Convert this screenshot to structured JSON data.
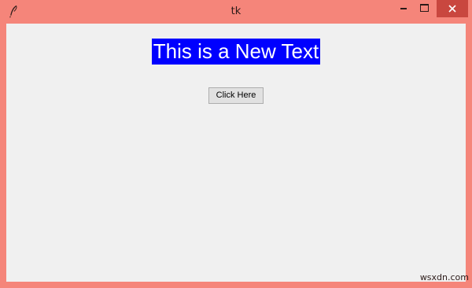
{
  "window": {
    "title": "tk",
    "icon": "tk-feather-icon",
    "controls": {
      "minimize": "minimize-icon",
      "maximize": "maximize-icon",
      "close": "close-icon"
    },
    "frame_color": "#f5857a",
    "close_color": "#c9473f"
  },
  "content": {
    "label_text": "This is a New Text",
    "label_bg": "#0000ff",
    "label_fg": "#ffffff",
    "button_label": "Click Here"
  },
  "watermark": "wsxdn.com"
}
